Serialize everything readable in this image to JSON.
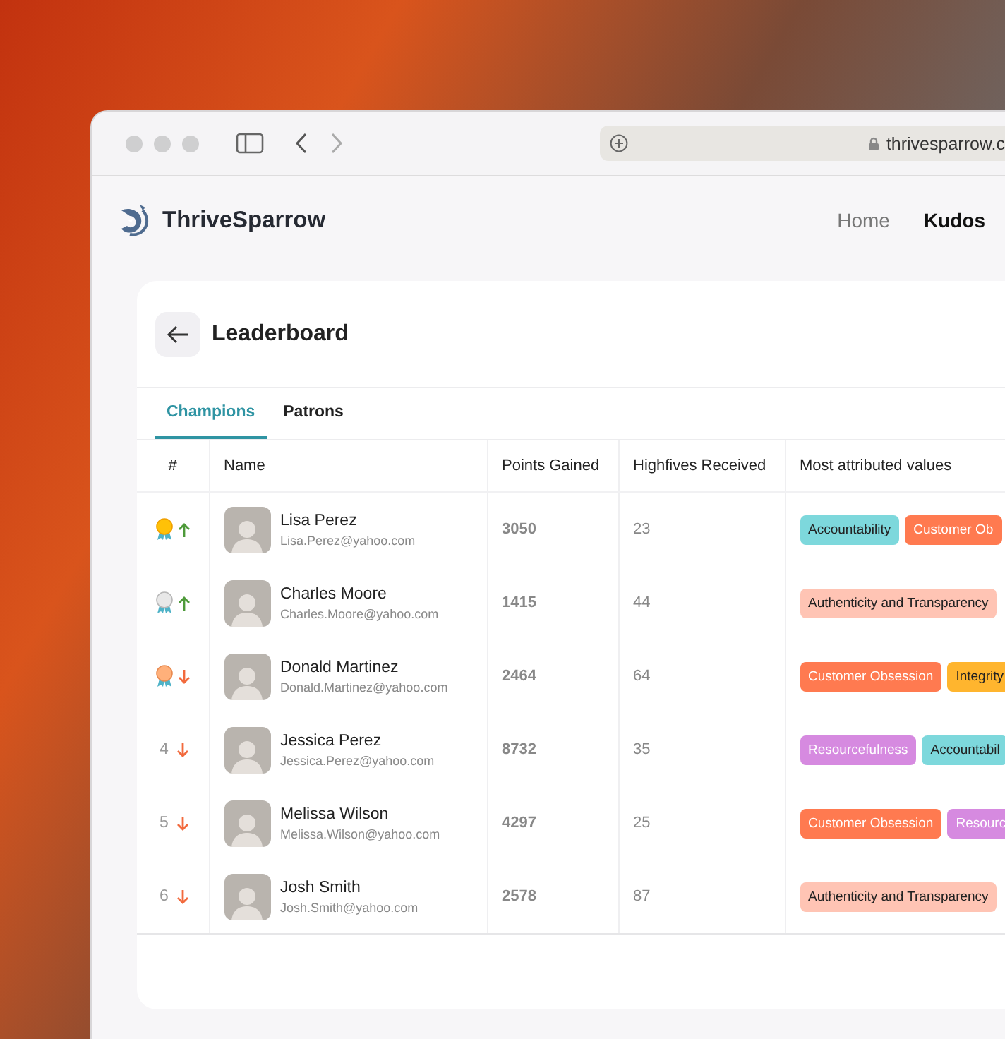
{
  "browser": {
    "url": "thrivesparrow.c"
  },
  "app": {
    "brand": "ThriveSparrow",
    "nav": [
      {
        "label": "Home",
        "selected": false
      },
      {
        "label": "Kudos",
        "selected": true
      }
    ]
  },
  "page": {
    "title": "Leaderboard"
  },
  "tabs": [
    {
      "label": "Champions",
      "selected": true
    },
    {
      "label": "Patrons",
      "selected": false
    }
  ],
  "table": {
    "columns": [
      "#",
      "Name",
      "Points Gained",
      "Highfives Received",
      "Most attributed values"
    ],
    "rows": [
      {
        "kind": "gold",
        "rising": true,
        "name": "Lisa Perez",
        "email": "Lisa.Perez@yahoo.com",
        "points": "3050",
        "highfives": "23",
        "values": [
          {
            "label": "Accountability",
            "color": "#7dd8dc"
          },
          {
            "label": "Customer Ob",
            "color": "#ff7a50"
          }
        ]
      },
      {
        "kind": "silver",
        "rising": true,
        "name": "Charles Moore",
        "email": "Charles.Moore@yahoo.com",
        "points": "1415",
        "highfives": "44",
        "values": [
          {
            "label": "Authenticity and Transparency",
            "color": "#ffc4b4"
          }
        ]
      },
      {
        "kind": "bronze",
        "rising": false,
        "name": "Donald Martinez",
        "email": "Donald.Martinez@yahoo.com",
        "points": "2464",
        "highfives": "64",
        "values": [
          {
            "label": "Customer Obsession",
            "color": "#ff7a50"
          },
          {
            "label": "Integrity",
            "color": "#ffb52e"
          }
        ]
      },
      {
        "kind": "number",
        "rank": "4",
        "rising": false,
        "name": "Jessica Perez",
        "email": "Jessica.Perez@yahoo.com",
        "points": "8732",
        "highfives": "35",
        "values": [
          {
            "label": "Resourcefulness",
            "color": "#d68ae0"
          },
          {
            "label": "Accountabil",
            "color": "#7dd8dc"
          }
        ]
      },
      {
        "kind": "number",
        "rank": "5",
        "rising": false,
        "name": "Melissa Wilson",
        "email": "Melissa.Wilson@yahoo.com",
        "points": "4297",
        "highfives": "25",
        "values": [
          {
            "label": "Customer Obsession",
            "color": "#ff7a50"
          },
          {
            "label": "Resourc",
            "color": "#d68ae0"
          }
        ]
      },
      {
        "kind": "number",
        "rank": "6",
        "rising": false,
        "name": "Josh Smith",
        "email": "Josh.Smith@yahoo.com",
        "points": "2578",
        "highfives": "87",
        "values": [
          {
            "label": "Authenticity and Transparency",
            "color": "#ffc4b4"
          }
        ]
      }
    ]
  }
}
